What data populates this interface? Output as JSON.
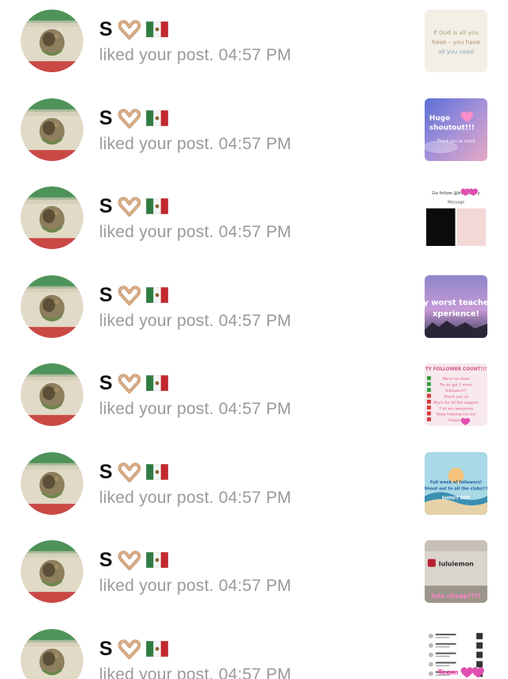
{
  "notifications": [
    {
      "username": "S",
      "action": "liked your post.",
      "time": "04:57 PM",
      "thumb": {
        "kind": "quote",
        "lines": [
          "If God is all you",
          "have – you have",
          "all you need"
        ]
      }
    },
    {
      "username": "S",
      "action": "liked your post.",
      "time": "04:57 PM",
      "thumb": {
        "kind": "sky",
        "lines": [
          "Huge",
          "shoutout!!!",
          "Thank you so much"
        ]
      }
    },
    {
      "username": "S",
      "action": "liked your post.",
      "time": "04:57 PM",
      "thumb": {
        "kind": "screens",
        "lines": [
          "Go follow @itscherrrry",
          "Message"
        ]
      }
    },
    {
      "username": "S",
      "action": "liked your post.",
      "time": "04:57 PM",
      "thumb": {
        "kind": "dusk",
        "lines": [
          "y worst teache",
          "xperience!"
        ]
      }
    },
    {
      "username": "S",
      "action": "liked your post.",
      "time": "04:57 PM",
      "thumb": {
        "kind": "checklist",
        "lines": [
          "TY FOLLOWER COUNT!!!",
          "We're so close",
          "Try to get 1 more",
          "followers!!!",
          "Thank you so",
          "Much for all the support",
          "Y'all are awesome",
          "Keep helping me out",
          "Happy!!"
        ]
      }
    },
    {
      "username": "S",
      "action": "liked your post.",
      "time": "04:57 PM",
      "thumb": {
        "kind": "beach",
        "lines": [
          "Full week of followers!",
          "Shout out to all the clubs!!!",
          "SHOUT OUT"
        ]
      }
    },
    {
      "username": "S",
      "action": "liked your post.",
      "time": "04:57 PM",
      "thumb": {
        "kind": "store",
        "lines": [
          "lululemon",
          "lulu cheap?!?!"
        ]
      }
    },
    {
      "username": "S",
      "action": "liked your post.",
      "time": "04:57 PM",
      "thumb": {
        "kind": "list",
        "lines": [
          "Team"
        ]
      }
    }
  ],
  "icons": {
    "avatar": "mexican-flag-avatar-icon",
    "hands": "heart-hands-emoji-icon",
    "flag": "mexico-flag-emoji-icon"
  },
  "colors": {
    "flag_green": "#2f7d43",
    "flag_red": "#c3282f",
    "muted_text": "#9a9a9a"
  }
}
